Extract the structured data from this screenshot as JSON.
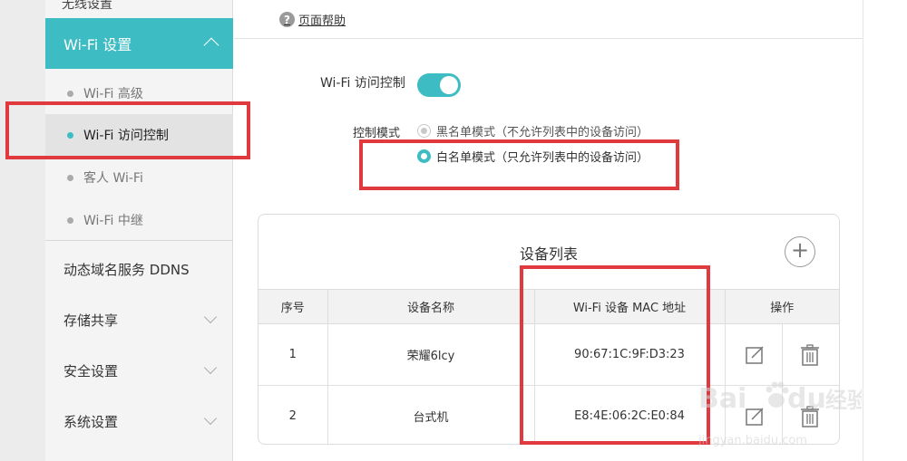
{
  "sidebar": {
    "top_cut_label": "无线设置",
    "active_menu": "Wi-Fi 设置",
    "sub_items": [
      {
        "label": "Wi-Fi 高级",
        "selected": false
      },
      {
        "label": "Wi-Fi 访问控制",
        "selected": true
      },
      {
        "label": "客人 Wi-Fi",
        "selected": false
      },
      {
        "label": "Wi-Fi 中继",
        "selected": false
      }
    ],
    "menu_items": [
      {
        "label": "动态域名服务 DDNS",
        "has_chevron": false
      },
      {
        "label": "存储共享",
        "has_chevron": true
      },
      {
        "label": "安全设置",
        "has_chevron": true
      },
      {
        "label": "系统设置",
        "has_chevron": true
      }
    ]
  },
  "main": {
    "help_link": "页面帮助",
    "help_icon": "?",
    "wifi_access_control_label": "Wi-Fi 访问控制",
    "wifi_access_control_enabled": true,
    "mode_label": "控制模式",
    "modes": [
      {
        "label": "黑名单模式（不允许列表中的设备访问）",
        "checked": false
      },
      {
        "label": "白名单模式（只允许列表中的设备访问）",
        "checked": true
      }
    ]
  },
  "device_list": {
    "title": "设备列表",
    "add_icon": "+",
    "columns": [
      "序号",
      "设备名称",
      "Wi-Fi 设备 MAC 地址",
      "操作"
    ],
    "rows": [
      {
        "index": "1",
        "name": "荣耀6lcy",
        "mac": "90:67:1C:9F:D3:23"
      },
      {
        "index": "2",
        "name": "台式机",
        "mac": "E8:4E:06:2C:E0:84"
      }
    ]
  },
  "watermark": {
    "brand": "Bai",
    "brand2": "du",
    "cn": "经验",
    "url": "jingyan.baidu.com"
  },
  "colors": {
    "accent": "#3dbdc3",
    "annotation": "#e0393e"
  }
}
